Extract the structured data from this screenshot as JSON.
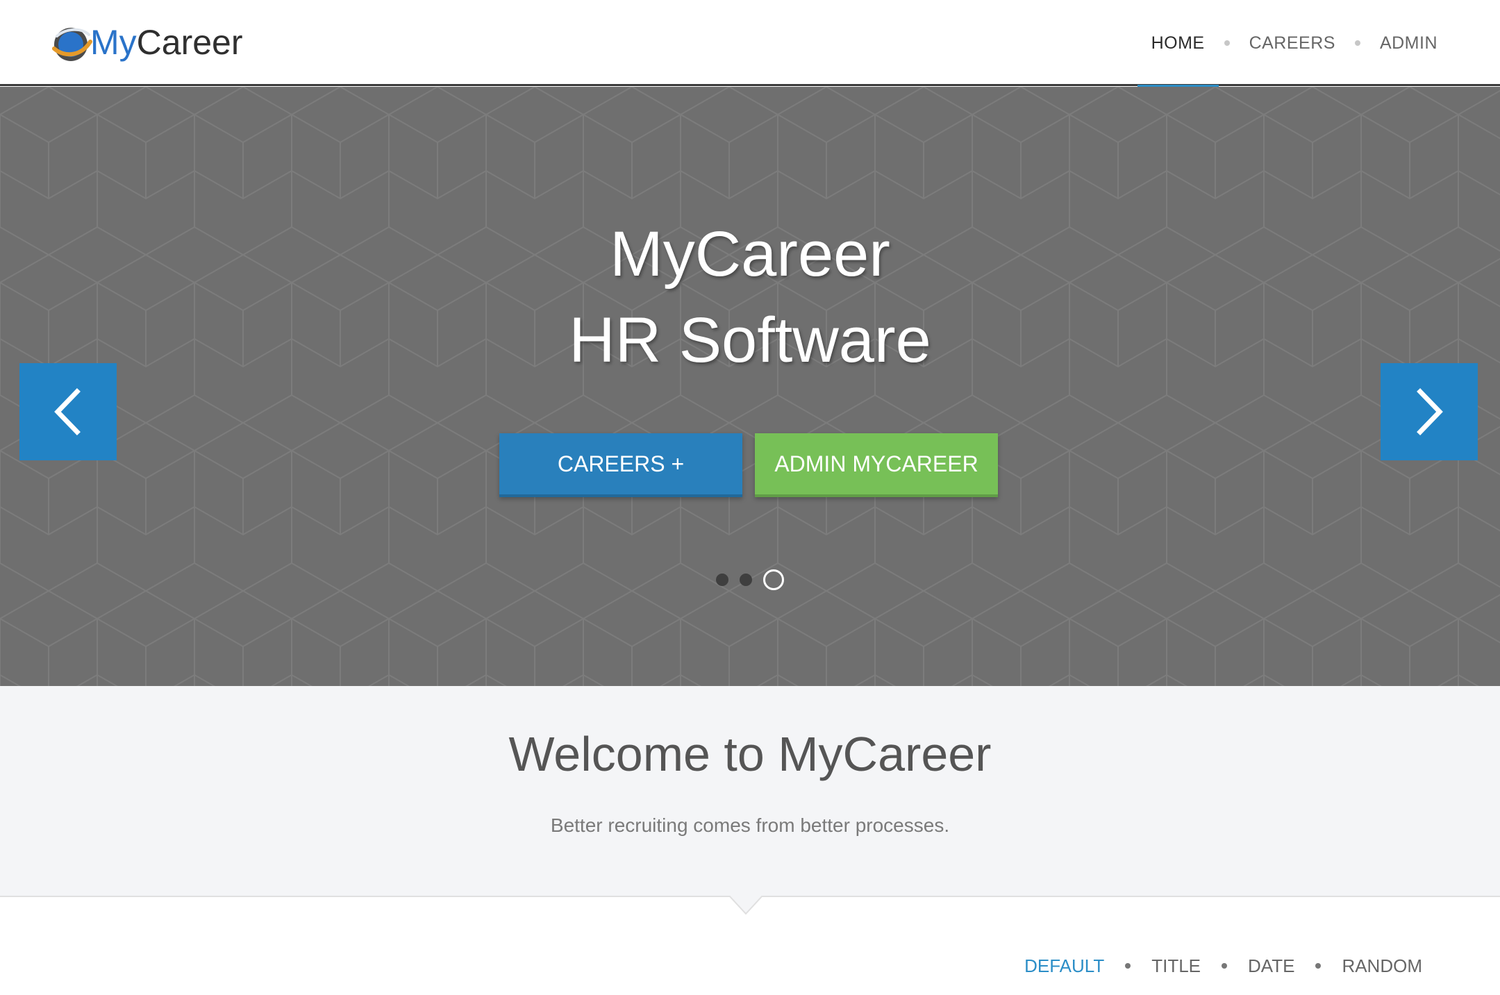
{
  "header": {
    "logo_my": "My",
    "logo_rest": "Career",
    "nav": [
      {
        "label": "HOME",
        "active": true
      },
      {
        "label": "CAREERS",
        "active": false
      },
      {
        "label": "ADMIN",
        "active": false
      }
    ]
  },
  "hero": {
    "title_line1": "MyCareer",
    "title_line2": "HR Software",
    "btn_careers": "CAREERS +",
    "btn_admin": "ADMIN MYCAREER",
    "slide_count": 3,
    "active_slide": 3
  },
  "welcome": {
    "title": "Welcome to MyCareer",
    "subtitle": "Better recruiting comes from better processes."
  },
  "sort": {
    "items": [
      {
        "label": "DEFAULT",
        "active": true
      },
      {
        "label": "TITLE",
        "active": false
      },
      {
        "label": "DATE",
        "active": false
      },
      {
        "label": "RANDOM",
        "active": false
      }
    ]
  },
  "colors": {
    "accent": "#2c8ec7",
    "careers_button": "#2980bc",
    "admin_button": "#77c057",
    "hero_bg": "#6f6f6f"
  }
}
